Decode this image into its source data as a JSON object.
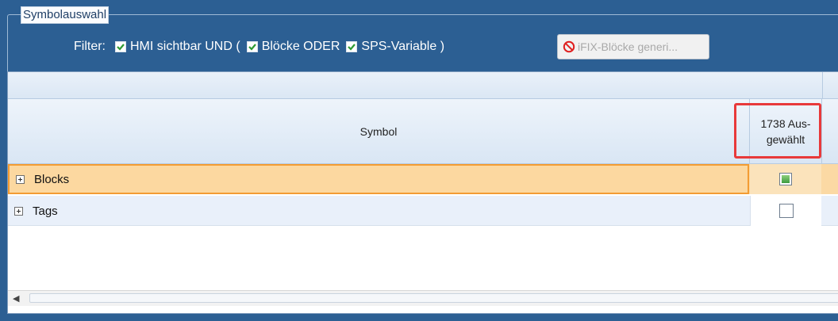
{
  "window": {
    "group_title": "Symbolauswahl"
  },
  "filter": {
    "label": "Filter:",
    "option1": "HMI sichtbar UND (",
    "option2": "Blöcke ODER",
    "option3": "SPS-Variable )",
    "generate_button": "iFIX-Blöcke generi..."
  },
  "grid": {
    "columns": {
      "symbol": "Symbol",
      "selected_line1": "1738 Aus-",
      "selected_line2": "gewählt"
    },
    "rows": [
      {
        "label": "Blocks",
        "checkbox_state": "partial"
      },
      {
        "label": "Tags",
        "checkbox_state": "unchecked"
      }
    ],
    "scroll_left_arrow": "◀"
  },
  "colors": {
    "frame": "#2c5f93",
    "row_selected": "#fbd9a4",
    "highlight_box": "#e8393a",
    "check_green": "#3c9b3f"
  }
}
